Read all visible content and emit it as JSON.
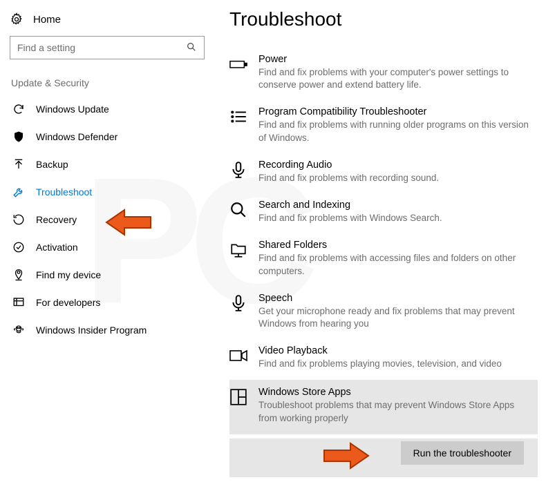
{
  "home_label": "Home",
  "search_placeholder": "Find a setting",
  "sidebar_section": "Update & Security",
  "nav": [
    {
      "label": "Windows Update"
    },
    {
      "label": "Windows Defender"
    },
    {
      "label": "Backup"
    },
    {
      "label": "Troubleshoot"
    },
    {
      "label": "Recovery"
    },
    {
      "label": "Activation"
    },
    {
      "label": "Find my device"
    },
    {
      "label": "For developers"
    },
    {
      "label": "Windows Insider Program"
    }
  ],
  "page_title": "Troubleshoot",
  "items": [
    {
      "title": "Power",
      "desc": "Find and fix problems with your computer's power settings to conserve power and extend battery life."
    },
    {
      "title": "Program Compatibility Troubleshooter",
      "desc": "Find and fix problems with running older programs on this version of Windows."
    },
    {
      "title": "Recording Audio",
      "desc": "Find and fix problems with recording sound."
    },
    {
      "title": "Search and Indexing",
      "desc": "Find and fix problems with Windows Search."
    },
    {
      "title": "Shared Folders",
      "desc": "Find and fix problems with accessing files and folders on other computers."
    },
    {
      "title": "Speech",
      "desc": "Get your microphone ready and fix problems that may prevent Windows from hearing you"
    },
    {
      "title": "Video Playback",
      "desc": "Find and fix problems playing movies, television, and video"
    },
    {
      "title": "Windows Store Apps",
      "desc": "Troubleshoot problems that may prevent Windows Store Apps from working properly"
    }
  ],
  "run_button": "Run the troubleshooter"
}
